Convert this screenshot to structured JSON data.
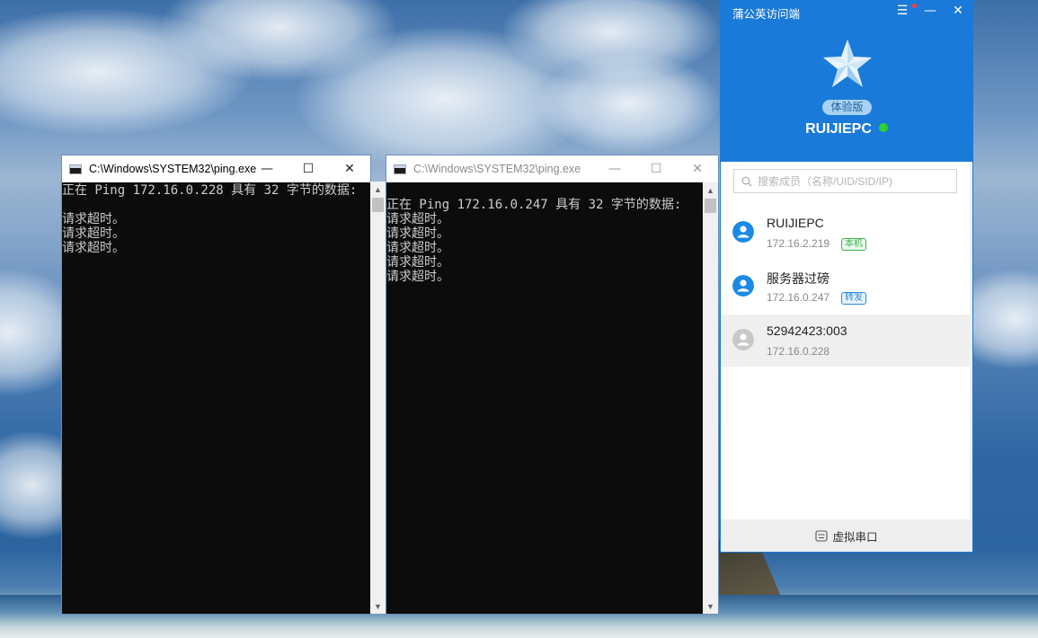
{
  "window1": {
    "title": "C:\\Windows\\SYSTEM32\\ping.exe",
    "lines": [
      "正在 Ping 172.16.0.228 具有 32 字节的数据:",
      "",
      "请求超时。",
      "请求超时。",
      "请求超时。"
    ]
  },
  "window2": {
    "title": "C:\\Windows\\SYSTEM32\\ping.exe",
    "lines": [
      "",
      "正在 Ping 172.16.0.247 具有 32 字节的数据:",
      "请求超时。",
      "请求超时。",
      "请求超时。",
      "请求超时。",
      "请求超时。"
    ]
  },
  "window_controls": {
    "minimize": "—",
    "maximize": "☐",
    "close": "✕"
  },
  "app": {
    "title": "蒲公英访问端",
    "edition": "体验版",
    "hostname": "RUIJIEPC",
    "search": {
      "placeholder": "搜索成员（名称/UID/SID/IP)"
    },
    "members": [
      {
        "name": "RUIJIEPC",
        "ip": "172.16.2.219",
        "tag": "本机",
        "online": true
      },
      {
        "name": "服务器过磅",
        "ip": "172.16.0.247",
        "tag": "转发",
        "online": true
      },
      {
        "name": "52942423:003",
        "ip": "172.16.0.228",
        "tag": "",
        "online": false
      }
    ],
    "footer": "虚拟串口",
    "colors": {
      "brand": "#1a7ad9",
      "online": "#2fd12f",
      "offline": "#c8c8c8"
    }
  }
}
